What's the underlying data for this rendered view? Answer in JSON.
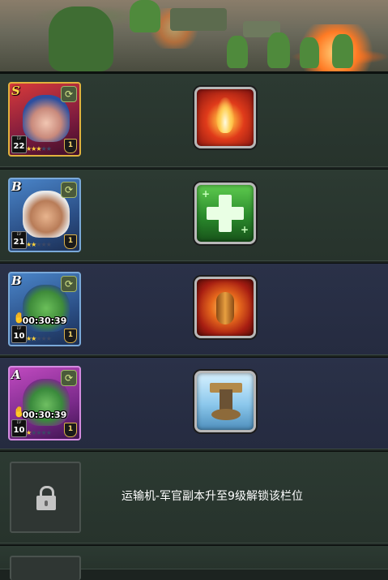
{
  "cards": [
    {
      "grade": "S",
      "level_tag": "LV",
      "level": "22",
      "stars_on": 3,
      "stars_total": 5,
      "rank": "1",
      "timer": "",
      "skill": "fire-burst-skill"
    },
    {
      "grade": "B",
      "level_tag": "LV",
      "level": "21",
      "stars_on": 2,
      "stars_total": 5,
      "rank": "1",
      "timer": "",
      "skill": "heal-cross-skill"
    },
    {
      "grade": "B",
      "level_tag": "LV",
      "level": "10",
      "stars_on": 2,
      "stars_total": 5,
      "rank": "1",
      "timer": "00:30:39",
      "skill": "bomb-strike-skill"
    },
    {
      "grade": "A",
      "level_tag": "LV",
      "level": "10",
      "stars_on": 1,
      "stars_total": 5,
      "rank": "1",
      "timer": "00:30:39",
      "skill": "cannon-tower-skill"
    }
  ],
  "locked": {
    "message": "运输机-军官副本升至9级解锁该栏位",
    "icon": "lock-icon"
  },
  "colors": {
    "row_green": "#2c3a32",
    "row_blue": "#2a3148",
    "star_on": "#ffd23a"
  }
}
